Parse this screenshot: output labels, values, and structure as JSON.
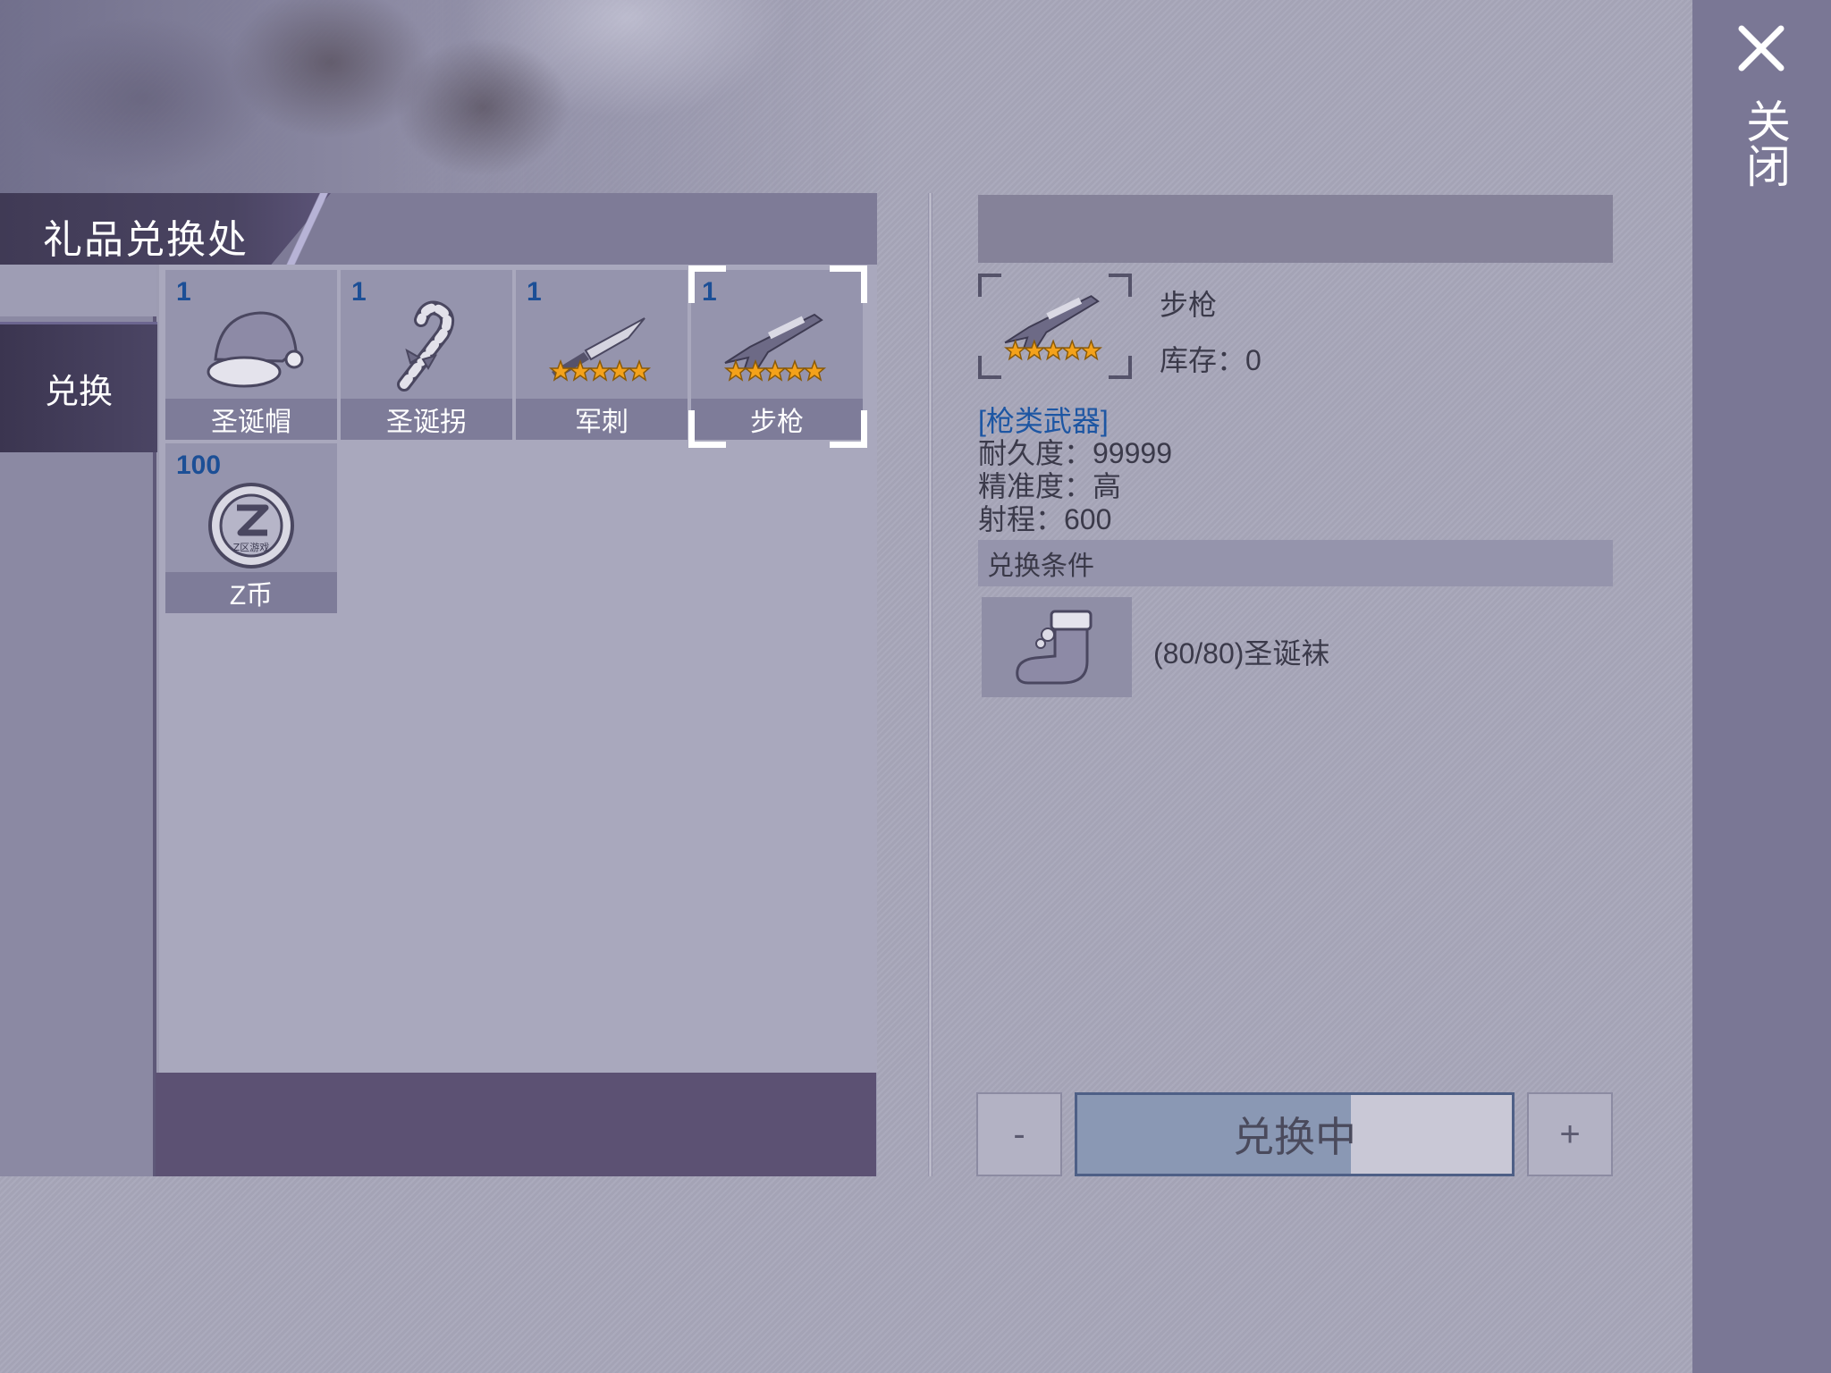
{
  "title": "礼品兑换处",
  "sidebar": {
    "tab_label": "兑换"
  },
  "items": [
    {
      "count": "1",
      "label": "圣诞帽",
      "icon": "santa-hat-icon"
    },
    {
      "count": "1",
      "label": "圣诞拐",
      "icon": "candy-cane-icon"
    },
    {
      "count": "1",
      "label": "军刺",
      "icon": "bayonet-icon",
      "stars": 5
    },
    {
      "count": "1",
      "label": "步枪",
      "icon": "rifle-icon",
      "stars": 5,
      "selected": true
    },
    {
      "count": "100",
      "label": "Z币",
      "icon": "z-coin-icon",
      "coin_text": "Z区游戏"
    }
  ],
  "detail": {
    "name": "步枪",
    "stock": "库存：0",
    "stars": 5,
    "category": "[枪类武器]",
    "durability": "耐久度：99999",
    "accuracy": "精准度：高",
    "range": "射程：600",
    "condition_header": "兑换条件",
    "requirement": "(80/80)圣诞袜",
    "requirement_icon": "christmas-stocking-icon"
  },
  "actions": {
    "minus": "-",
    "exchange": "兑换中",
    "exchange_progress": 0.63,
    "plus": "+"
  },
  "close": {
    "label": "关闭"
  },
  "colors": {
    "count": "#1c4f96",
    "category": "#1d56a3",
    "panel": "#9d9cb2",
    "accent": "#5c5173"
  }
}
